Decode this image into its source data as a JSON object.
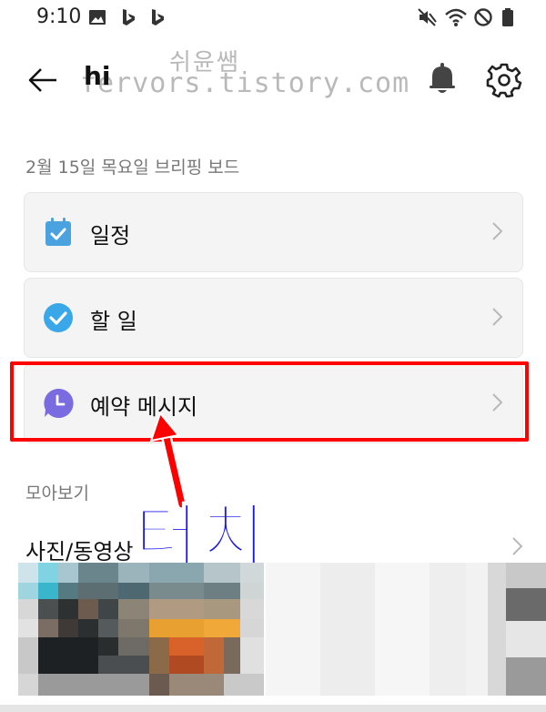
{
  "status_bar": {
    "time": "9:10",
    "left_icons": [
      "image-icon",
      "bing-icon",
      "bing-icon"
    ],
    "right_icons": [
      "mute-icon",
      "wifi-icon",
      "dnd-icon",
      "battery-icon"
    ]
  },
  "watermark": {
    "line1": "쉬윤쌤",
    "line2": "fervors.tistory.com"
  },
  "header": {
    "title": "hi",
    "icons": [
      "back-arrow-icon",
      "bell-icon",
      "gear-icon"
    ]
  },
  "briefing": {
    "label": "2월 15일 목요일 브리핑 보드",
    "items": [
      {
        "label": "일정",
        "icon": "calendar-icon",
        "color": "#4aa3df"
      },
      {
        "label": "할 일",
        "icon": "check-circle-icon",
        "color": "#3aa7e8"
      },
      {
        "label": "예약 메시지",
        "icon": "clock-bubble-icon",
        "color": "#7b6be0"
      }
    ]
  },
  "overlay": {
    "text": "터치",
    "highlight_color": "#ff0000",
    "text_color": "#1a1ae6"
  },
  "collection": {
    "label": "모아보기",
    "photo_label": "사진/동영상"
  }
}
